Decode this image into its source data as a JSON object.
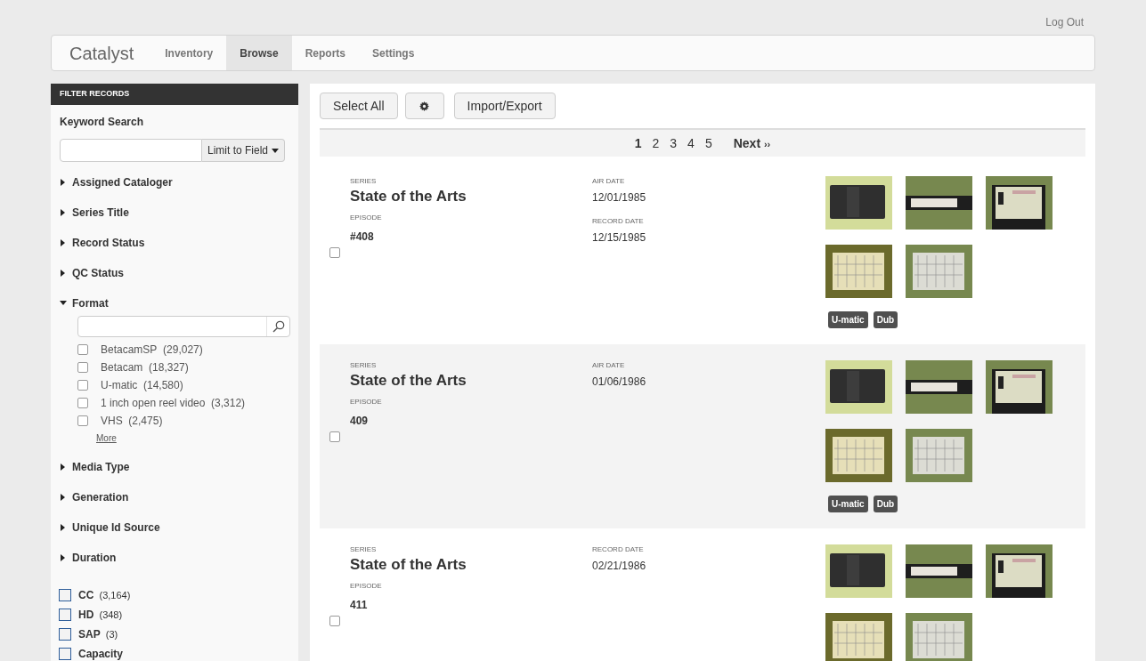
{
  "top_link": "Log Out",
  "nav": {
    "brand": "Catalyst",
    "items": [
      {
        "label": "Inventory",
        "selected": false
      },
      {
        "label": "Browse",
        "selected": true
      },
      {
        "label": "Reports",
        "selected": false
      },
      {
        "label": "Settings",
        "selected": false
      }
    ]
  },
  "sidebar": {
    "title": "FILTER RECORDS",
    "keyword_label": "Keyword Search",
    "limit_button": "Limit to Field",
    "facets": [
      {
        "label": "Assigned Cataloger",
        "expanded": false
      },
      {
        "label": "Series Title",
        "expanded": false
      },
      {
        "label": "Record Status",
        "expanded": false
      },
      {
        "label": "QC Status",
        "expanded": false
      },
      {
        "label": "Format",
        "expanded": true,
        "options": [
          {
            "label": "BetacamSP",
            "count": "(29,027)",
            "checked": false
          },
          {
            "label": "Betacam",
            "count": "(18,327)",
            "checked": false
          },
          {
            "label": "U-matic",
            "count": "(14,580)",
            "checked": false
          },
          {
            "label": "1 inch open reel video",
            "count": "(3,312)",
            "checked": false
          },
          {
            "label": "VHS",
            "count": "(2,475)",
            "checked": false
          }
        ],
        "more": "More"
      },
      {
        "label": "Media Type",
        "expanded": false
      },
      {
        "label": "Generation",
        "expanded": false
      },
      {
        "label": "Unique Id Source",
        "expanded": false
      },
      {
        "label": "Duration",
        "expanded": false
      }
    ],
    "flags": [
      {
        "label": "CC",
        "count": "(3,164)",
        "checked": false
      },
      {
        "label": "HD",
        "count": "(348)",
        "checked": false
      },
      {
        "label": "SAP",
        "count": "(3)",
        "checked": false
      },
      {
        "label": "Capacity",
        "checked": false
      }
    ]
  },
  "toolbar": {
    "select_all": "Select All",
    "import_export": "Import/Export"
  },
  "pagination": {
    "pages": [
      {
        "label": "1",
        "selected": true
      },
      {
        "label": "2",
        "selected": false
      },
      {
        "label": "3",
        "selected": false
      },
      {
        "label": "4",
        "selected": false
      },
      {
        "label": "5",
        "selected": false
      }
    ],
    "next": "Next",
    "next_icon": "››"
  },
  "records": [
    {
      "checked": false,
      "series_label": "SERIES",
      "series": "State of the Arts",
      "episode_label": "EPISODE",
      "episode": "#408",
      "dates": [
        {
          "label": "AIR DATE",
          "value": "12/01/1985"
        },
        {
          "label": "RECORD DATE",
          "value": "12/15/1985"
        }
      ],
      "thumbnails": [
        {
          "kind": "picture"
        },
        {
          "kind": "picture"
        },
        {
          "kind": "picture"
        },
        {
          "kind": "picture"
        },
        {
          "kind": "picture"
        }
      ],
      "tags": [
        "U-matic",
        "Dub"
      ]
    },
    {
      "checked": false,
      "series_label": "SERIES",
      "series": "State of the Arts",
      "episode_label": "EPISODE",
      "episode": "409",
      "dates": [
        {
          "label": "AIR DATE",
          "value": "01/06/1986"
        }
      ],
      "thumbnails": [
        {
          "kind": "picture"
        },
        {
          "kind": "picture"
        },
        {
          "kind": "picture"
        },
        {
          "kind": "picture"
        },
        {
          "kind": "picture"
        }
      ],
      "tags": [
        "U-matic",
        "Dub"
      ]
    },
    {
      "checked": false,
      "series_label": "SERIES",
      "series": "State of the Arts",
      "episode_label": "EPISODE",
      "episode": "411",
      "dates": [
        {
          "label": "RECORD DATE",
          "value": "02/21/1986"
        }
      ],
      "thumbnails": [
        {
          "kind": "picture"
        },
        {
          "kind": "picture"
        },
        {
          "kind": "picture"
        },
        {
          "kind": "picture"
        },
        {
          "kind": "picture"
        }
      ]
    }
  ]
}
